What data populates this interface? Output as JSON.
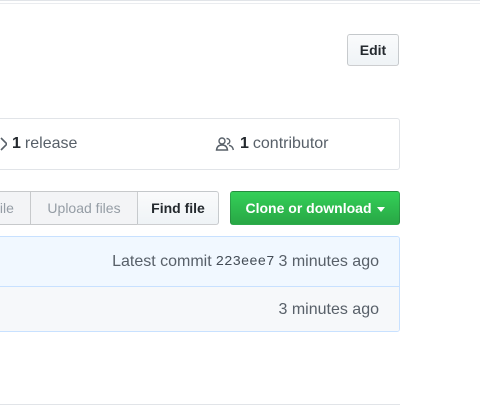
{
  "toolbar": {
    "edit_label": "Edit"
  },
  "summary": {
    "releases_count": "1",
    "releases_label": "release",
    "contributors_count": "1",
    "contributors_label": "contributor"
  },
  "file_actions": {
    "create_label": "file",
    "upload_label": "Upload files",
    "find_label": "Find file",
    "clone_label": "Clone or download"
  },
  "commit": {
    "prefix": "Latest commit",
    "sha": "223eee7",
    "age": "3 minutes ago"
  },
  "file_row": {
    "age": "3 minutes ago"
  },
  "colors": {
    "accent_green": "#28a745",
    "commit_bg": "#f1f8ff",
    "border": "#e1e4e8"
  },
  "icons": {
    "release": "tag-icon",
    "contributors": "people-icon",
    "dropdown": "caret-down-icon"
  }
}
